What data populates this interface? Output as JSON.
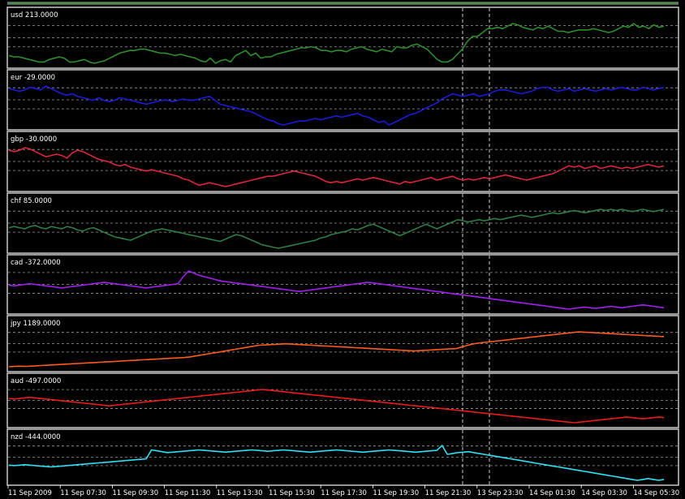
{
  "colors": {
    "background": "#000000",
    "panel_border": "#c8c8c8",
    "grid_dashed": "#9a9a9a",
    "session_line": "#ffffff",
    "label_text": "#ffffff",
    "axis_text": "#ffffff"
  },
  "chart_data": [
    {
      "type": "line",
      "label": "usd 213.0000",
      "series": [
        {
          "color": "#2e8b2e",
          "values": [
            41,
            40,
            40,
            39,
            38,
            37,
            36,
            36,
            38,
            39,
            40,
            39,
            36,
            36,
            37,
            38,
            36,
            35,
            36,
            37,
            39,
            41,
            43,
            44,
            45,
            45,
            46,
            46,
            45,
            44,
            43,
            43,
            42,
            41,
            42,
            41,
            40,
            39,
            37,
            36,
            39,
            35,
            37,
            38,
            36,
            41,
            43,
            45,
            41,
            43,
            39,
            40,
            40,
            42,
            43,
            44,
            45,
            46,
            47,
            47,
            48,
            47,
            45,
            45,
            44,
            45,
            45,
            44,
            46,
            47,
            48,
            46,
            45,
            44,
            46,
            45,
            44,
            48,
            47,
            47,
            49,
            50,
            48,
            46,
            42,
            38,
            36,
            36,
            38,
            42,
            46,
            52,
            56,
            56,
            59,
            62,
            62,
            63,
            62,
            64,
            66,
            65,
            63,
            62,
            61,
            63,
            62,
            64,
            62,
            60,
            60,
            59,
            60,
            61,
            61,
            61,
            62,
            61,
            60,
            59,
            60,
            62,
            64,
            63,
            66,
            63,
            64,
            62,
            65,
            63,
            64
          ]
        }
      ]
    },
    {
      "type": "line",
      "label": "eur -29.0000",
      "series": [
        {
          "color": "#1a1ad8",
          "values": [
            -29,
            -30,
            -31,
            -30,
            -28,
            -29,
            -30,
            -27,
            -29,
            -31,
            -33,
            -34,
            -33,
            -35,
            -36,
            -37,
            -38,
            -36,
            -38,
            -39,
            -38,
            -36,
            -37,
            -38,
            -39,
            -40,
            -41,
            -40,
            -39,
            -38,
            -38,
            -39,
            -38,
            -37,
            -38,
            -38,
            -37,
            -36,
            -35,
            -38,
            -41,
            -42,
            -43,
            -44,
            -45,
            -46,
            -47,
            -49,
            -51,
            -53,
            -54,
            -56,
            -57,
            -56,
            -55,
            -54,
            -54,
            -53,
            -52,
            -53,
            -52,
            -51,
            -50,
            -51,
            -50,
            -49,
            -48,
            -50,
            -51,
            -53,
            -55,
            -54,
            -57,
            -55,
            -53,
            -51,
            -49,
            -48,
            -46,
            -44,
            -42,
            -40,
            -37,
            -35,
            -33,
            -34,
            -35,
            -34,
            -33,
            -35,
            -34,
            -33,
            -31,
            -30,
            -30,
            -31,
            -32,
            -33,
            -32,
            -31,
            -29,
            -28,
            -28,
            -30,
            -31,
            -30,
            -29,
            -31,
            -30,
            -29,
            -30,
            -31,
            -30,
            -29,
            -30,
            -29,
            -28,
            -29,
            -30,
            -30,
            -28,
            -29,
            -30,
            -29,
            -28
          ]
        }
      ]
    },
    {
      "type": "line",
      "label": "gbp -30.0000",
      "series": [
        {
          "color": "#dc2640",
          "values": [
            -30,
            -31,
            -30,
            -28,
            -29,
            -31,
            -33,
            -35,
            -34,
            -33,
            -34,
            -36,
            -32,
            -30,
            -31,
            -33,
            -35,
            -37,
            -38,
            -39,
            -41,
            -42,
            -41,
            -43,
            -44,
            -45,
            -46,
            -45,
            -46,
            -47,
            -48,
            -49,
            -50,
            -52,
            -53,
            -55,
            -57,
            -56,
            -55,
            -56,
            -57,
            -58,
            -57,
            -56,
            -55,
            -54,
            -53,
            -52,
            -51,
            -50,
            -50,
            -49,
            -48,
            -47,
            -46,
            -47,
            -48,
            -49,
            -50,
            -52,
            -54,
            -55,
            -54,
            -55,
            -54,
            -53,
            -52,
            -53,
            -52,
            -51,
            -52,
            -53,
            -54,
            -55,
            -56,
            -54,
            -55,
            -54,
            -53,
            -52,
            -51,
            -53,
            -52,
            -51,
            -50,
            -52,
            -53,
            -52,
            -53,
            -52,
            -51,
            -52,
            -51,
            -50,
            -49,
            -50,
            -51,
            -52,
            -53,
            -52,
            -51,
            -50,
            -49,
            -48,
            -46,
            -44,
            -42,
            -43,
            -42,
            -44,
            -43,
            -42,
            -44,
            -43,
            -42,
            -43,
            -44,
            -43,
            -44,
            -43,
            -42,
            -41,
            -42,
            -43,
            -42
          ]
        }
      ]
    },
    {
      "type": "line",
      "label": "chf 85.0000",
      "series": [
        {
          "color": "#2e7d4a",
          "values": [
            85,
            86,
            85,
            84,
            86,
            87,
            85,
            84,
            86,
            85,
            84,
            86,
            85,
            83,
            82,
            84,
            85,
            83,
            81,
            79,
            77,
            76,
            75,
            74,
            76,
            78,
            80,
            82,
            83,
            84,
            83,
            82,
            81,
            80,
            79,
            78,
            77,
            76,
            75,
            74,
            73,
            75,
            77,
            79,
            78,
            76,
            74,
            72,
            70,
            69,
            68,
            67,
            68,
            69,
            70,
            71,
            72,
            73,
            74,
            76,
            77,
            79,
            80,
            81,
            82,
            84,
            83,
            85,
            87,
            88,
            86,
            84,
            82,
            80,
            78,
            80,
            82,
            84,
            86,
            88,
            86,
            84,
            86,
            88,
            90,
            92,
            91,
            90,
            91,
            92,
            91,
            92,
            93,
            92,
            93,
            94,
            95,
            96,
            95,
            94,
            95,
            96,
            97,
            98,
            97,
            98,
            99,
            100,
            99,
            98,
            99,
            100,
            101,
            100,
            101,
            100,
            101,
            100,
            99,
            100,
            101,
            100,
            99,
            100,
            101
          ]
        }
      ]
    },
    {
      "type": "line",
      "label": "cad -372.0000",
      "series": [
        {
          "color": "#a020f0",
          "values": [
            -372,
            -373,
            -372,
            -371,
            -370,
            -371,
            -372,
            -373,
            -374,
            -375,
            -376,
            -375,
            -374,
            -373,
            -372,
            -371,
            -370,
            -369,
            -368,
            -369,
            -370,
            -371,
            -372,
            -373,
            -374,
            -375,
            -376,
            -375,
            -374,
            -373,
            -372,
            -371,
            -370,
            -360,
            -352,
            -355,
            -358,
            -360,
            -362,
            -364,
            -366,
            -367,
            -368,
            -369,
            -370,
            -371,
            -372,
            -373,
            -374,
            -375,
            -376,
            -377,
            -378,
            -379,
            -380,
            -381,
            -380,
            -379,
            -378,
            -377,
            -376,
            -375,
            -374,
            -373,
            -372,
            -371,
            -370,
            -369,
            -368,
            -369,
            -370,
            -371,
            -372,
            -373,
            -374,
            -375,
            -376,
            -377,
            -378,
            -379,
            -380,
            -381,
            -382,
            -383,
            -384,
            -385,
            -386,
            -387,
            -388,
            -389,
            -390,
            -391,
            -392,
            -393,
            -394,
            -395,
            -396,
            -397,
            -398,
            -399,
            -400,
            -401,
            -402,
            -403,
            -404,
            -405,
            -406,
            -405,
            -404,
            -403,
            -404,
            -405,
            -404,
            -403,
            -402,
            -403,
            -404,
            -403,
            -402,
            -401,
            -400,
            -401,
            -402,
            -403,
            -404
          ]
        }
      ]
    },
    {
      "type": "line",
      "label": "jpy 1189.0000",
      "series": [
        {
          "color": "#ff5a1f",
          "values": [
            1189,
            1190,
            1191,
            1190,
            1191,
            1192,
            1193,
            1194,
            1195,
            1196,
            1197,
            1198,
            1199,
            1200,
            1201,
            1202,
            1203,
            1204,
            1205,
            1206,
            1207,
            1208,
            1209,
            1210,
            1211,
            1212,
            1213,
            1214,
            1215,
            1216,
            1217,
            1218,
            1219,
            1220,
            1222,
            1225,
            1228,
            1231,
            1234,
            1237,
            1240,
            1243,
            1246,
            1249,
            1252,
            1255,
            1258,
            1261,
            1262,
            1263,
            1264,
            1265,
            1266,
            1265,
            1264,
            1263,
            1262,
            1261,
            1260,
            1259,
            1258,
            1257,
            1256,
            1255,
            1254,
            1253,
            1252,
            1251,
            1250,
            1249,
            1248,
            1247,
            1246,
            1245,
            1244,
            1243,
            1242,
            1243,
            1244,
            1245,
            1246,
            1247,
            1248,
            1249,
            1250,
            1255,
            1260,
            1265,
            1268,
            1270,
            1272,
            1274,
            1276,
            1278,
            1280,
            1282,
            1284,
            1286,
            1288,
            1290,
            1292,
            1294,
            1296,
            1298,
            1300,
            1302,
            1304,
            1306,
            1305,
            1304,
            1303,
            1302,
            1301,
            1300,
            1299,
            1298,
            1297,
            1296,
            1295,
            1294,
            1293,
            1292,
            1291,
            1290
          ]
        }
      ]
    },
    {
      "type": "line",
      "label": "aud -497.0000",
      "series": [
        {
          "color": "#ee1b1b",
          "values": [
            -497,
            -498,
            -497,
            -496,
            -495,
            -496,
            -497,
            -498,
            -499,
            -500,
            -501,
            -502,
            -503,
            -504,
            -505,
            -506,
            -507,
            -508,
            -509,
            -510,
            -509,
            -508,
            -507,
            -506,
            -505,
            -504,
            -503,
            -502,
            -501,
            -500,
            -499,
            -498,
            -497,
            -496,
            -495,
            -494,
            -493,
            -492,
            -491,
            -490,
            -489,
            -488,
            -487,
            -486,
            -485,
            -484,
            -483,
            -482,
            -481,
            -482,
            -483,
            -484,
            -485,
            -486,
            -487,
            -488,
            -489,
            -490,
            -491,
            -492,
            -493,
            -494,
            -495,
            -496,
            -497,
            -498,
            -499,
            -500,
            -501,
            -502,
            -503,
            -504,
            -505,
            -506,
            -507,
            -508,
            -509,
            -510,
            -511,
            -512,
            -513,
            -514,
            -515,
            -516,
            -517,
            -518,
            -519,
            -520,
            -521,
            -522,
            -523,
            -524,
            -525,
            -526,
            -527,
            -528,
            -529,
            -530,
            -531,
            -532,
            -533,
            -534,
            -535,
            -536,
            -537,
            -538,
            -539,
            -540,
            -539,
            -538,
            -537,
            -536,
            -535,
            -534,
            -533,
            -532,
            -531,
            -530,
            -531,
            -532,
            -533,
            -532,
            -531,
            -530,
            -531
          ]
        }
      ]
    },
    {
      "type": "line",
      "label": "nzd -444.0000",
      "series": [
        {
          "color": "#2ee0f0",
          "values": [
            -444,
            -445,
            -444,
            -443,
            -444,
            -445,
            -446,
            -447,
            -448,
            -447,
            -446,
            -445,
            -444,
            -443,
            -442,
            -441,
            -440,
            -439,
            -438,
            -437,
            -436,
            -435,
            -434,
            -433,
            -432,
            -431,
            -430,
            -410,
            -412,
            -414,
            -416,
            -415,
            -414,
            -413,
            -412,
            -411,
            -410,
            -411,
            -412,
            -413,
            -414,
            -415,
            -414,
            -413,
            -412,
            -411,
            -410,
            -411,
            -412,
            -413,
            -412,
            -411,
            -410,
            -411,
            -412,
            -413,
            -414,
            -415,
            -414,
            -413,
            -412,
            -411,
            -410,
            -411,
            -412,
            -413,
            -414,
            -415,
            -414,
            -413,
            -412,
            -411,
            -410,
            -411,
            -412,
            -413,
            -414,
            -415,
            -414,
            -413,
            -412,
            -411,
            -400,
            -420,
            -418,
            -416,
            -415,
            -414,
            -416,
            -418,
            -420,
            -422,
            -424,
            -426,
            -428,
            -430,
            -432,
            -434,
            -436,
            -438,
            -440,
            -442,
            -444,
            -446,
            -448,
            -450,
            -452,
            -454,
            -456,
            -458,
            -460,
            -462,
            -464,
            -466,
            -468,
            -470,
            -472,
            -474,
            -476,
            -478,
            -476,
            -474,
            -476,
            -478,
            -476
          ]
        }
      ]
    }
  ],
  "x_axis": {
    "labels": [
      "11 Sep 2009",
      "11 Sep 07:30",
      "11 Sep 09:30",
      "11 Sep 11:30",
      "11 Sep 13:30",
      "11 Sep 15:30",
      "11 Sep 17:30",
      "11 Sep 19:30",
      "11 Sep 21:30",
      "13 Sep 23:30",
      "14 Sep 01:30",
      "14 Sep 03:30",
      "14 Sep 05:30"
    ]
  }
}
